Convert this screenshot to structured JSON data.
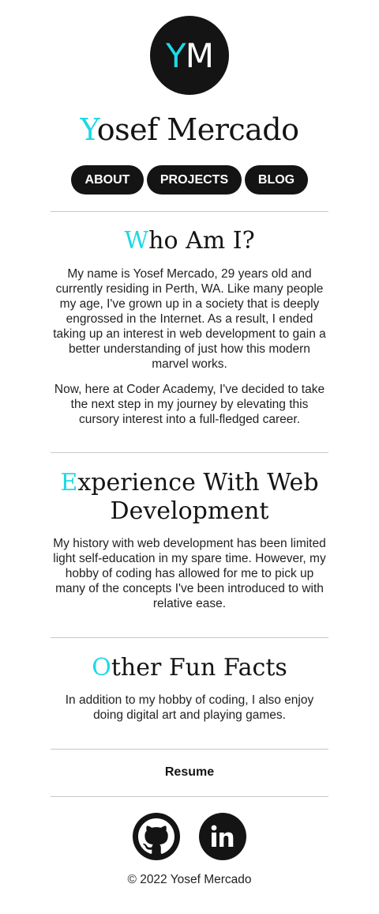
{
  "header": {
    "logo_first": "Y",
    "logo_rest": "M",
    "name_first": "Y",
    "name_rest": "osef Mercado"
  },
  "nav": {
    "about": "ABOUT",
    "projects": "PROJECTS",
    "blog": "BLOG"
  },
  "sections": [
    {
      "title_first": "W",
      "title_rest": "ho Am I?",
      "paragraphs": [
        "My name is Yosef Mercado, 29 years old and currently residing in Perth, WA. Like many people my age, I've grown up in a society that is deeply engrossed in the Internet. As a result, I ended taking up an interest in web development to gain a better understanding of just how this modern marvel works.",
        "Now, here at Coder Academy, I've decided to take the next step in my journey by elevating this cursory interest into a full-fledged career."
      ]
    },
    {
      "title_first": "E",
      "title_rest": "xperience With Web Development",
      "paragraphs": [
        "My history with web development has been limited light self-education in my spare time. However, my hobby of coding has allowed for me to pick up many of the concepts I've been introduced to with relative ease."
      ]
    },
    {
      "title_first": "O",
      "title_rest": "ther Fun Facts",
      "paragraphs": [
        "In addition to my hobby of coding, I also enjoy doing digital art and playing games."
      ]
    }
  ],
  "footer": {
    "resume": "Resume",
    "social": [
      "github-icon",
      "linkedin-icon"
    ],
    "copyright": "© 2022 Yosef Mercado"
  },
  "colors": {
    "accent": "#1fd8e6",
    "dark": "#141414"
  }
}
